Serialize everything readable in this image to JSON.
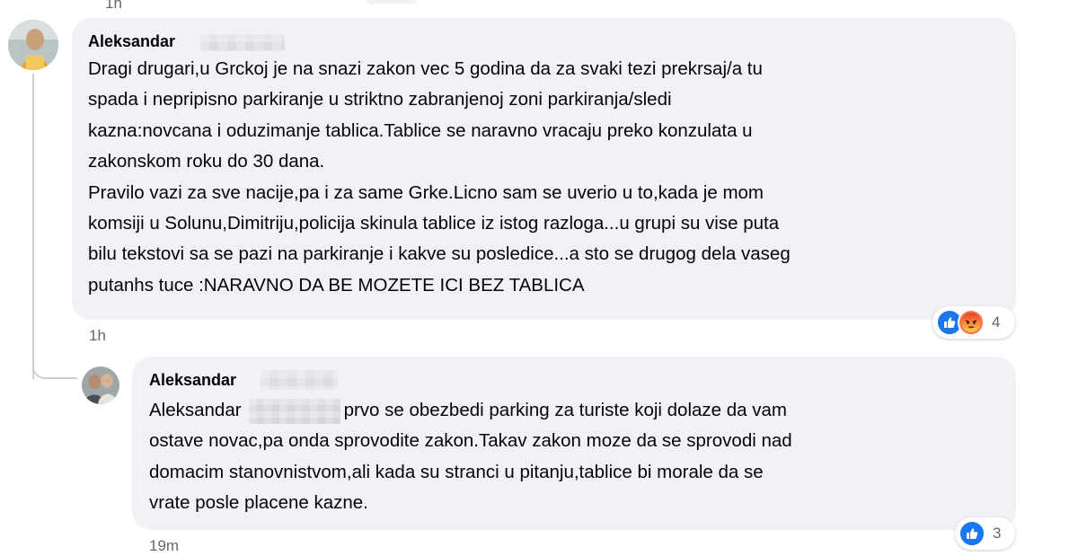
{
  "top": {
    "time": "1h"
  },
  "comments": [
    {
      "author": "Aleksandar",
      "lines": [
        "Dragi drugari,u Grckoj je na snazi zakon vec 5 godina da za svaki tezi prekrsaj/a tu",
        "spada i nepripisno parkiranje u striktno zabranjenoj zoni parkiranja/sledi",
        "kazna:novcana i oduzimanje tablica.Tablice se naravno vracaju preko konzulata u",
        "zakonskom roku do 30 dana.",
        "Pravilo vazi za sve nacije,pa i za same Grke.Licno sam se uverio u to,kada je mom",
        "komsiji u Solunu,Dimitriju,policija skinula tablice iz istog razloga...u grupi su vise puta",
        "bilu tekstovi sa se pazi na parkiranje i kakve su posledice...a sto se drugog dela vaseg",
        "putanhs tuce :NARAVNO DA BE MOZETE ICI BEZ TABLICA"
      ],
      "time": "1h",
      "reaction_count": "4",
      "reaction_icons": [
        "like-icon",
        "angry-icon"
      ]
    },
    {
      "author": "Aleksandar",
      "mention": "Aleksandar",
      "line1_rest": "prvo se obezbedi parking za turiste koji dolaze da vam",
      "lines": [
        "ostave novac,pa onda sprovodite zakon.Takav zakon moze da se sprovodi nad",
        "domacim stanovnistvom,ali kada su stranci u pitanju,tablice bi morale da se",
        "vrate posle placene kazne."
      ],
      "time": "19m",
      "reaction_count": "3",
      "reaction_icons": [
        "like-icon"
      ]
    }
  ],
  "colors": {
    "bubble": "#f0f2f5",
    "like": "#1877f2",
    "angry": "#f7714b",
    "meta_text": "#65676b"
  }
}
